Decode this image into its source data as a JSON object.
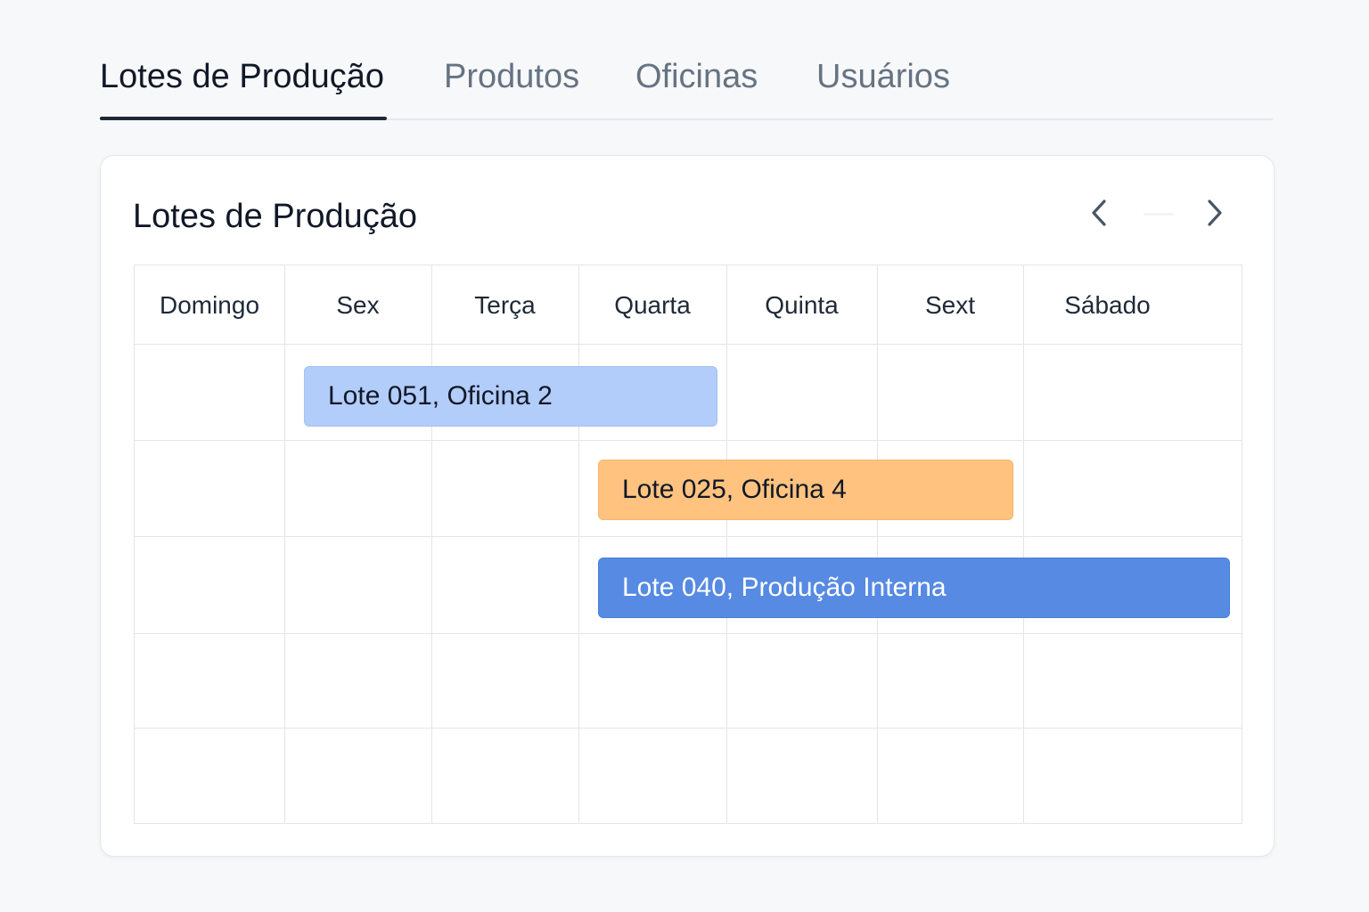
{
  "tabs": [
    {
      "label": "Lotes de Produção",
      "active": true
    },
    {
      "label": "Produtos",
      "active": false
    },
    {
      "label": "Oficinas",
      "active": false
    },
    {
      "label": "Usuários",
      "active": false
    }
  ],
  "card": {
    "title": "Lotes de Produção",
    "prev_icon": "chevron-left-icon",
    "next_icon": "chevron-right-icon"
  },
  "calendar": {
    "days": [
      "Domingo",
      "Sex",
      "Terça",
      "Quarta",
      "Quinta",
      "Sext",
      "Sábado"
    ],
    "events": [
      {
        "label": "Lote 051, Oficina 2",
        "color": "#b2cdfa"
      },
      {
        "label": "Lote 025, Oficina 4",
        "color": "#ffc37f"
      },
      {
        "label": "Lote 040, Produção Interna",
        "color": "#568ae3"
      }
    ]
  }
}
